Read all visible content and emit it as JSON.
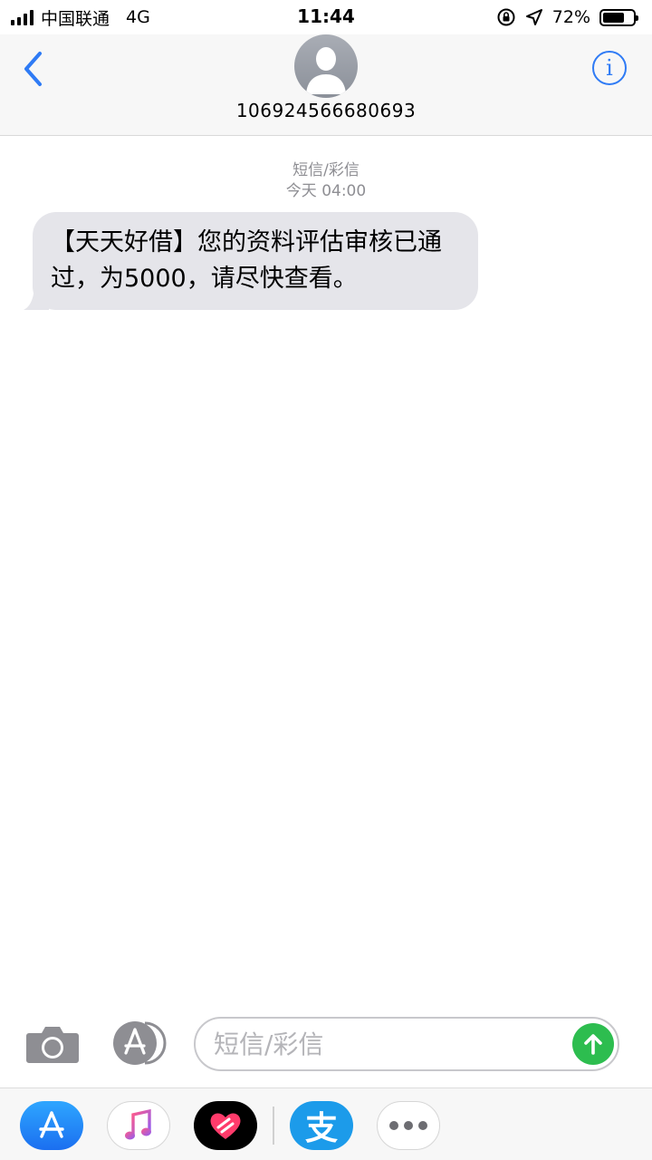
{
  "status_bar": {
    "carrier": "中国联通",
    "network": "4G",
    "time": "11:44",
    "battery_percent": "72%",
    "battery_level": 0.72
  },
  "header": {
    "contact": "106924566680693",
    "back_icon": "chevron-left-icon",
    "info_icon": "info-icon",
    "info_glyph": "i"
  },
  "conversation": {
    "message_type": "短信/彩信",
    "timestamp": "今天 04:00",
    "messages": [
      {
        "direction": "incoming",
        "text": "【天天好借】您的资料评估审核已通过，为5000，请尽快查看。"
      }
    ]
  },
  "composer": {
    "placeholder": "短信/彩信",
    "value": ""
  },
  "app_drawer": {
    "apps": [
      "app-store-icon",
      "music-icon",
      "heart-icon",
      "alipay-icon",
      "more-icon"
    ],
    "alipay_glyph": "支"
  },
  "colors": {
    "accent": "#2f7bf5",
    "incoming_bubble": "#e5e5ea",
    "send_button": "#2dbd4f"
  }
}
